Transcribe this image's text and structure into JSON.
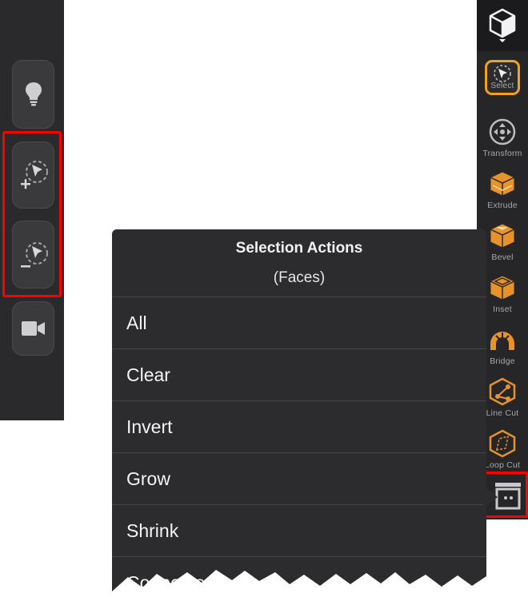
{
  "left_toolbar": {
    "buttons": [
      {
        "icon": "lightbulb-icon"
      },
      {
        "icon": "add-to-selection-icon"
      },
      {
        "icon": "remove-from-selection-icon"
      },
      {
        "icon": "camera-icon"
      }
    ]
  },
  "right_toolbar": {
    "top_icon": "cube-icon",
    "tools": [
      {
        "label": "Select",
        "icon": "select-icon",
        "active": true
      },
      {
        "label": "Transform",
        "icon": "transform-icon"
      },
      {
        "label": "Extrude",
        "icon": "extrude-icon"
      },
      {
        "label": "Bevel",
        "icon": "bevel-icon"
      },
      {
        "label": "Inset",
        "icon": "inset-icon"
      },
      {
        "label": "Bridge",
        "icon": "bridge-icon"
      },
      {
        "label": "Line Cut",
        "icon": "line-cut-icon"
      },
      {
        "label": "Loop Cut",
        "icon": "loop-cut-icon"
      }
    ],
    "bottom_icon": "more-actions-icon"
  },
  "popup": {
    "title": "Selection Actions",
    "subtitle": "(Faces)",
    "items": [
      "All",
      "Clear",
      "Invert",
      "Grow",
      "Shrink",
      "Connected"
    ]
  },
  "colors": {
    "accent": "#f0a21a",
    "highlight": "#ff0000",
    "panel": "#2c2c2e"
  }
}
